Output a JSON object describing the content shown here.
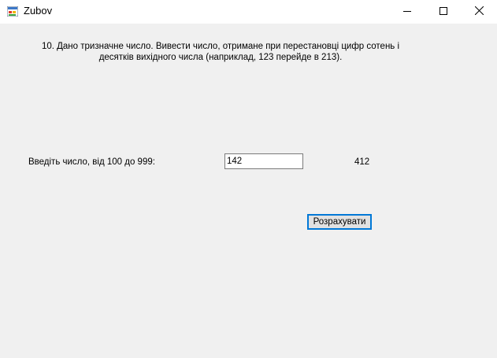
{
  "window": {
    "title": "Zubov",
    "icon": "winforms-app-icon",
    "controls": {
      "minimize_icon": "minimize-icon",
      "maximize_icon": "maximize-icon",
      "close_icon": "close-icon"
    }
  },
  "form": {
    "task_line1": "10. Дано тризначне число. Вивести число, отримане при перестановці цифр сотень і",
    "task_line2": "десятків вихідного числа (наприклад, 123 перейде в 213).",
    "input_label": "Введіть число, від 100 до 999:",
    "input_value": "142",
    "result_value": "412",
    "calculate_button": "Розрахувати"
  },
  "colors": {
    "background": "#f0f0f0",
    "titlebar": "#ffffff",
    "button_focus_border": "#0078d7",
    "button_face": "#e1e1e1"
  }
}
